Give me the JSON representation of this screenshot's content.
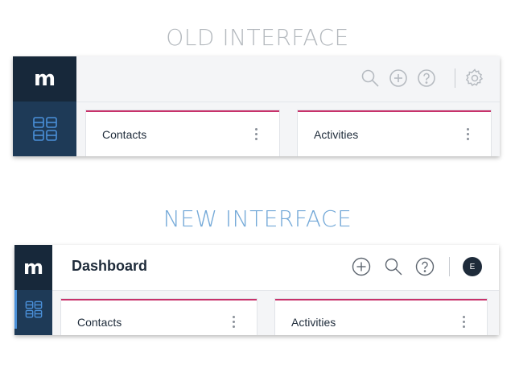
{
  "old": {
    "title": "OLD INTERFACE",
    "logo": "m",
    "cards": [
      {
        "label": "Contacts"
      },
      {
        "label": "Activities"
      }
    ],
    "toolbar_icons": [
      "search-icon",
      "add-icon",
      "help-icon",
      "settings-icon"
    ]
  },
  "new": {
    "title": "NEW INTERFACE",
    "logo": "m",
    "page_title": "Dashboard",
    "avatar_initial": "E",
    "cards": [
      {
        "label": "Contacts"
      },
      {
        "label": "Activities"
      }
    ],
    "toolbar_icons": [
      "add-icon",
      "search-icon",
      "help-icon"
    ]
  },
  "colors": {
    "rail": "#1e3a57",
    "logo_bg": "#17283a",
    "card_accent": "#c8326b",
    "new_title": "#74a9d8",
    "old_title": "#b4b9be"
  }
}
